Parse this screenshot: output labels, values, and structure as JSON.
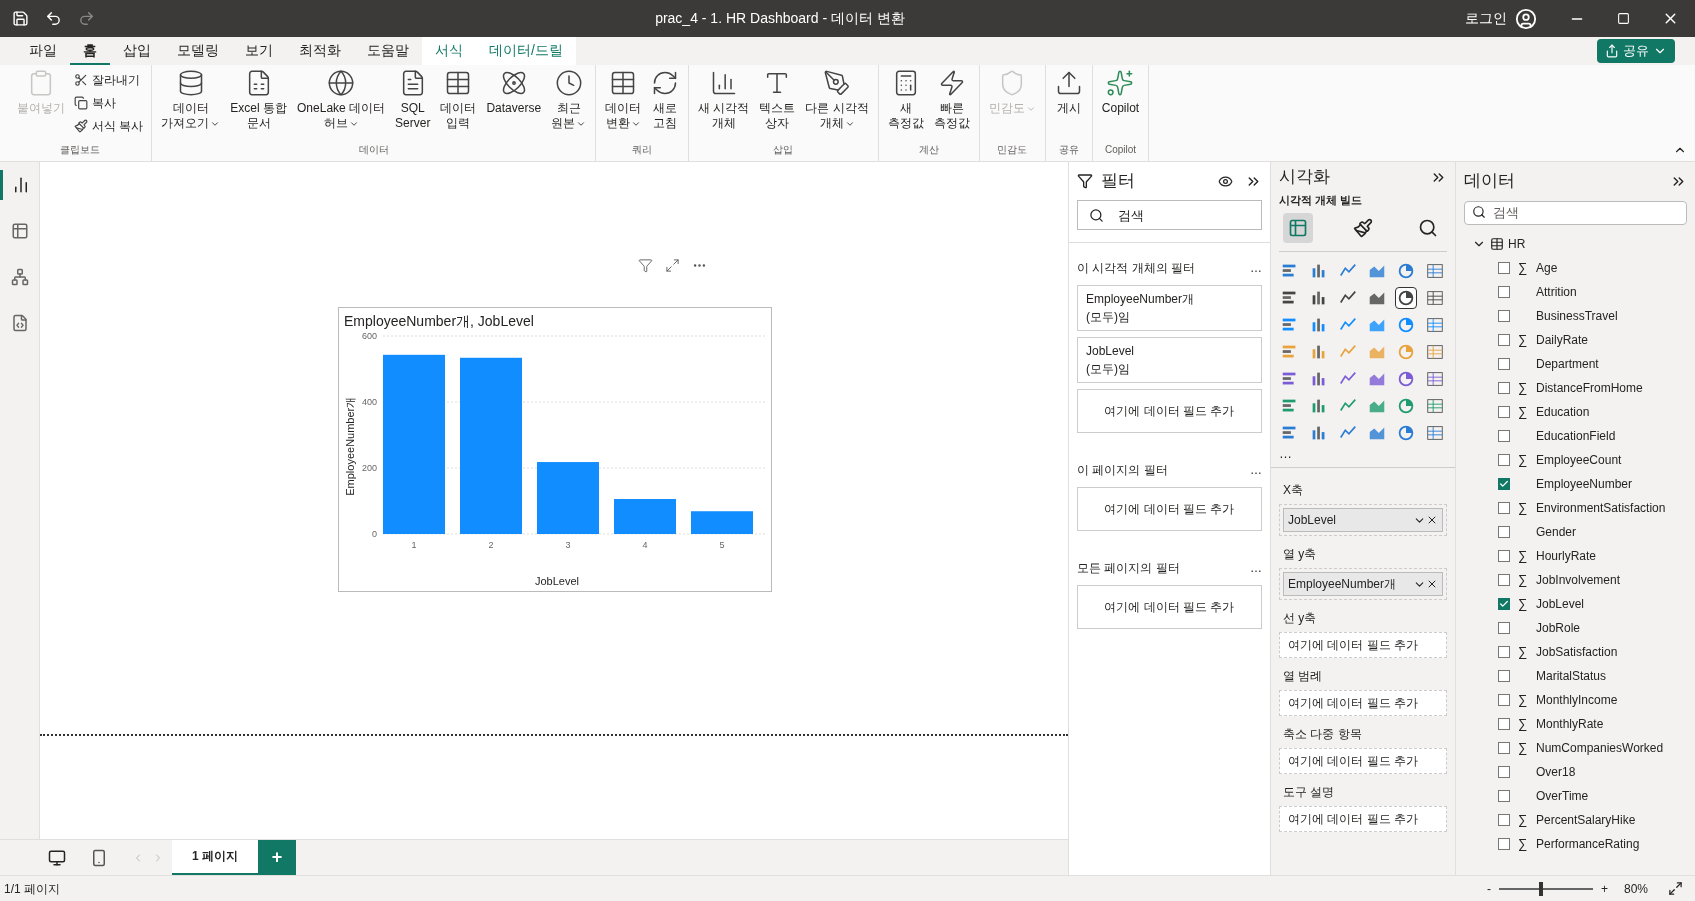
{
  "window": {
    "title": "prac_4 - 1. HR Dashboard - 데이터 변환",
    "login": "로그인"
  },
  "menu_tabs": [
    {
      "label": "파일",
      "selected": false,
      "contextual": false
    },
    {
      "label": "홈",
      "selected": true,
      "contextual": false
    },
    {
      "label": "삽입",
      "selected": false,
      "contextual": false
    },
    {
      "label": "모델링",
      "selected": false,
      "contextual": false
    },
    {
      "label": "보기",
      "selected": false,
      "contextual": false
    },
    {
      "label": "최적화",
      "selected": false,
      "contextual": false
    },
    {
      "label": "도움말",
      "selected": false,
      "contextual": false
    },
    {
      "label": "서식",
      "selected": false,
      "contextual": true
    },
    {
      "label": "데이터/드릴",
      "selected": false,
      "contextual": true
    }
  ],
  "share_button": "공유",
  "ribbon_groups": [
    {
      "name": "클립보드",
      "buttons": [
        {
          "kind": "large",
          "lines": [
            "붙여넣기"
          ],
          "disabled": true,
          "dropdown": false
        },
        {
          "kind": "small",
          "lines": [
            "잘라내기"
          ],
          "disabled": false,
          "dropdown": false
        },
        {
          "kind": "small",
          "lines": [
            "복사"
          ],
          "disabled": false,
          "dropdown": false
        },
        {
          "kind": "small",
          "lines": [
            "서식 복사"
          ],
          "disabled": false,
          "dropdown": false
        }
      ]
    },
    {
      "name": "데이터",
      "buttons": [
        {
          "kind": "large",
          "lines": [
            "데이터",
            "가져오기"
          ],
          "disabled": false,
          "dropdown": true
        },
        {
          "kind": "large",
          "lines": [
            "Excel 통합",
            "문서"
          ],
          "disabled": false,
          "dropdown": false
        },
        {
          "kind": "large",
          "lines": [
            "OneLake 데이터",
            "허브"
          ],
          "disabled": false,
          "dropdown": true
        },
        {
          "kind": "large",
          "lines": [
            "SQL",
            "Server"
          ],
          "disabled": false,
          "dropdown": false
        },
        {
          "kind": "large",
          "lines": [
            "데이터",
            "입력"
          ],
          "disabled": false,
          "dropdown": false
        },
        {
          "kind": "large",
          "lines": [
            "Dataverse"
          ],
          "disabled": false,
          "dropdown": false
        },
        {
          "kind": "large",
          "lines": [
            "최근",
            "원본"
          ],
          "disabled": false,
          "dropdown": true
        }
      ]
    },
    {
      "name": "쿼리",
      "buttons": [
        {
          "kind": "large",
          "lines": [
            "데이터",
            "변환"
          ],
          "disabled": false,
          "dropdown": true
        },
        {
          "kind": "large",
          "lines": [
            "새로",
            "고침"
          ],
          "disabled": false,
          "dropdown": false
        }
      ]
    },
    {
      "name": "삽입",
      "buttons": [
        {
          "kind": "large",
          "lines": [
            "새 시각적",
            "개체"
          ],
          "disabled": false,
          "dropdown": false
        },
        {
          "kind": "large",
          "lines": [
            "텍스트",
            "상자"
          ],
          "disabled": false,
          "dropdown": false
        },
        {
          "kind": "large",
          "lines": [
            "다른 시각적",
            "개체"
          ],
          "disabled": false,
          "dropdown": true
        }
      ]
    },
    {
      "name": "계산",
      "buttons": [
        {
          "kind": "large",
          "lines": [
            "새",
            "측정값"
          ],
          "disabled": false,
          "dropdown": false
        },
        {
          "kind": "large",
          "lines": [
            "빠른",
            "측정값"
          ],
          "disabled": false,
          "dropdown": false
        }
      ]
    },
    {
      "name": "민감도",
      "buttons": [
        {
          "kind": "large",
          "lines": [
            "민감도"
          ],
          "disabled": true,
          "dropdown": true
        }
      ]
    },
    {
      "name": "공유",
      "buttons": [
        {
          "kind": "large",
          "lines": [
            "게시"
          ],
          "disabled": false,
          "dropdown": false
        }
      ]
    },
    {
      "name": "Copilot",
      "buttons": [
        {
          "kind": "large",
          "lines": [
            "Copilot"
          ],
          "disabled": false,
          "dropdown": false
        }
      ]
    }
  ],
  "view_rail": [
    {
      "selected": true
    },
    {
      "selected": false
    },
    {
      "selected": false
    },
    {
      "selected": false
    }
  ],
  "visual": {
    "title": "EmployeeNumber개, JobLevel",
    "chart_data": {
      "type": "bar",
      "xlabel": "JobLevel",
      "ylabel": "EmployeeNumber개",
      "categories": [
        "1",
        "2",
        "3",
        "4",
        "5"
      ],
      "values": [
        543,
        534,
        218,
        106,
        69
      ],
      "ylim": [
        0,
        600
      ],
      "yticks": [
        0,
        200,
        400,
        600
      ]
    }
  },
  "filters": {
    "title": "필터",
    "search_placeholder": "검색",
    "sections": [
      {
        "title": "이 시각적 개체의 필터",
        "more": "…",
        "cards": [
          {
            "kind": "field",
            "name": "EmployeeNumber개",
            "condition": "(모두)임"
          },
          {
            "kind": "field",
            "name": "JobLevel",
            "condition": "(모두)임"
          },
          {
            "kind": "drop",
            "name": "여기에 데이터 필드 추가"
          }
        ]
      },
      {
        "title": "이 페이지의 필터",
        "more": "…",
        "cards": [
          {
            "kind": "drop",
            "name": "여기에 데이터 필드 추가"
          }
        ]
      },
      {
        "title": "모든 페이지의 필터",
        "more": "…",
        "cards": [
          {
            "kind": "drop",
            "name": "여기에 데이터 필드 추가"
          }
        ]
      }
    ]
  },
  "visualizations": {
    "title": "시각화",
    "subtitle": "시각적 개체 빌드",
    "modes": [
      {
        "selected": true
      },
      {
        "selected": false
      },
      {
        "selected": false
      }
    ],
    "more": "…",
    "chart_types": [
      {
        "selected": false
      },
      {
        "selected": false
      },
      {
        "selected": false
      },
      {
        "selected": false
      },
      {
        "selected": false
      },
      {
        "selected": false
      },
      {
        "selected": false
      },
      {
        "selected": false
      },
      {
        "selected": false
      },
      {
        "selected": false
      },
      {
        "selected": true
      },
      {
        "selected": false
      },
      {
        "selected": false
      },
      {
        "selected": false
      },
      {
        "selected": false
      },
      {
        "selected": false
      },
      {
        "selected": false
      },
      {
        "selected": false
      },
      {
        "selected": false
      },
      {
        "selected": false
      },
      {
        "selected": false
      },
      {
        "selected": false
      },
      {
        "selected": false
      },
      {
        "selected": false
      },
      {
        "selected": false
      },
      {
        "selected": false
      },
      {
        "selected": false
      },
      {
        "selected": false
      },
      {
        "selected": false
      },
      {
        "selected": false
      },
      {
        "selected": false
      },
      {
        "selected": false
      },
      {
        "selected": false
      },
      {
        "selected": false
      },
      {
        "selected": false
      },
      {
        "selected": false
      },
      {
        "selected": false
      },
      {
        "selected": false
      },
      {
        "selected": false
      },
      {
        "selected": false
      },
      {
        "selected": false
      },
      {
        "selected": false
      }
    ],
    "wells": [
      {
        "label": "X축",
        "field": "JobLevel"
      },
      {
        "label": "열 y축",
        "field": "EmployeeNumber개"
      },
      {
        "label": "선 y축",
        "placeholder": "여기에 데이터 필드 추가"
      },
      {
        "label": "열 범례",
        "placeholder": "여기에 데이터 필드 추가"
      },
      {
        "label": "축소 다중 항목",
        "placeholder": "여기에 데이터 필드 추가"
      },
      {
        "label": "도구 설명",
        "placeholder": "여기에 데이터 필드 추가"
      }
    ]
  },
  "data": {
    "title": "데이터",
    "search_placeholder": "검색",
    "table": {
      "name": "HR",
      "expanded": true,
      "fields": [
        {
          "name": "Age",
          "sigma": "∑",
          "checked": false
        },
        {
          "name": "Attrition",
          "checked": false
        },
        {
          "name": "BusinessTravel",
          "checked": false
        },
        {
          "name": "DailyRate",
          "sigma": "∑",
          "checked": false
        },
        {
          "name": "Department",
          "checked": false
        },
        {
          "name": "DistanceFromHome",
          "sigma": "∑",
          "checked": false
        },
        {
          "name": "Education",
          "sigma": "∑",
          "checked": false
        },
        {
          "name": "EducationField",
          "checked": false
        },
        {
          "name": "EmployeeCount",
          "sigma": "∑",
          "checked": false
        },
        {
          "name": "EmployeeNumber",
          "checked": true
        },
        {
          "name": "EnvironmentSatisfaction",
          "sigma": "∑",
          "checked": false
        },
        {
          "name": "Gender",
          "checked": false
        },
        {
          "name": "HourlyRate",
          "sigma": "∑",
          "checked": false
        },
        {
          "name": "JobInvolvement",
          "sigma": "∑",
          "checked": false
        },
        {
          "name": "JobLevel",
          "sigma": "∑",
          "checked": true
        },
        {
          "name": "JobRole",
          "checked": false
        },
        {
          "name": "JobSatisfaction",
          "sigma": "∑",
          "checked": false
        },
        {
          "name": "MaritalStatus",
          "checked": false
        },
        {
          "name": "MonthlyIncome",
          "sigma": "∑",
          "checked": false
        },
        {
          "name": "MonthlyRate",
          "sigma": "∑",
          "checked": false
        },
        {
          "name": "NumCompaniesWorked",
          "sigma": "∑",
          "checked": false
        },
        {
          "name": "Over18",
          "checked": false
        },
        {
          "name": "OverTime",
          "checked": false
        },
        {
          "name": "PercentSalaryHike",
          "sigma": "∑",
          "checked": false
        },
        {
          "name": "PerformanceRating",
          "sigma": "∑",
          "checked": false
        }
      ]
    }
  },
  "page_tabs": [
    {
      "label": "1 페이지",
      "selected": true
    }
  ],
  "add_page": "+",
  "status_bar": {
    "page": "1/1 페이지",
    "zoom_minus": "-",
    "zoom_plus": "+",
    "zoom": "80%",
    "level": 0.45
  }
}
